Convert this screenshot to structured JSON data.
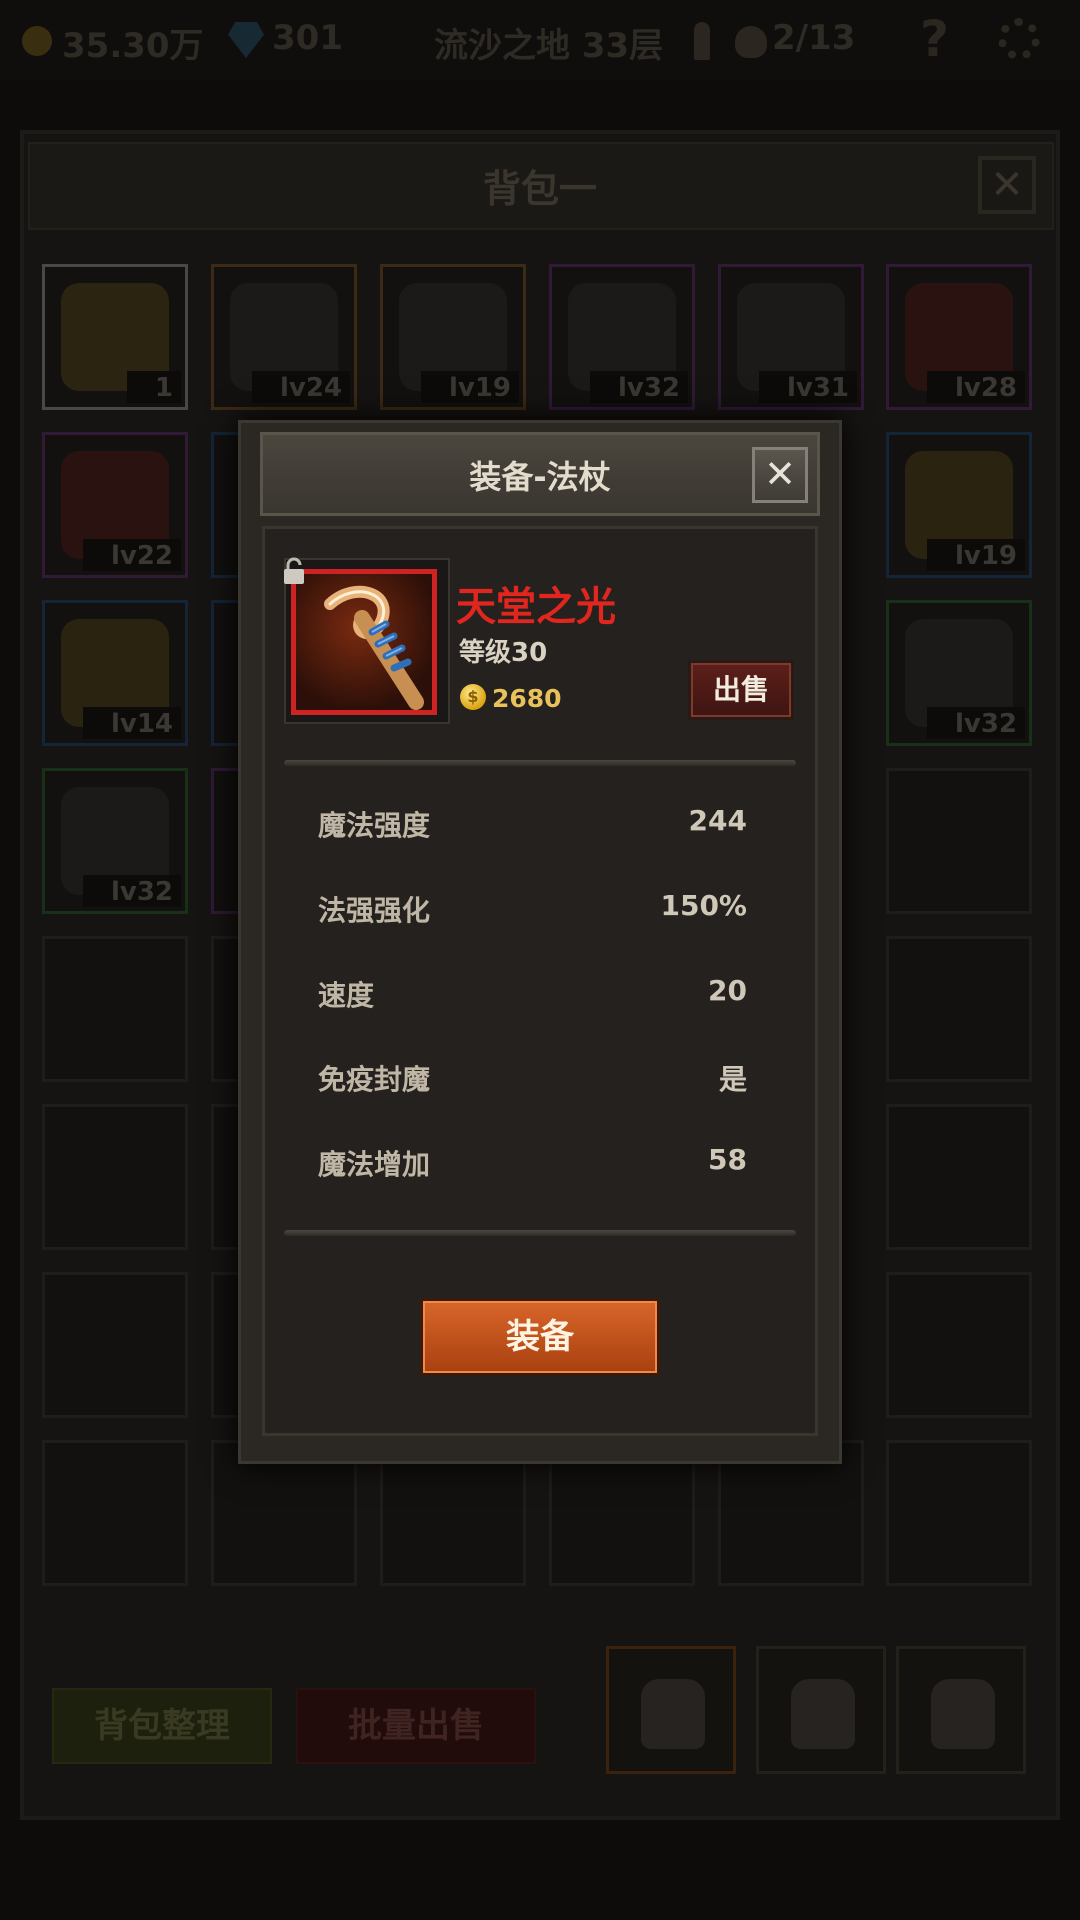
{
  "topbar": {
    "gold": "35.30万",
    "gems": "301",
    "location": "流沙之地 33层",
    "monsters": "2/13",
    "help": "?"
  },
  "bag": {
    "title": "背包一",
    "close": "✕",
    "slots": [
      {
        "lv": "1"
      },
      {
        "lv": "lv24"
      },
      {
        "lv": "lv19"
      },
      {
        "lv": "lv32"
      },
      {
        "lv": "lv31"
      },
      {
        "lv": "lv28"
      },
      {
        "lv": "lv22"
      },
      {
        "lv": "lv19"
      },
      {
        "lv": "lv14"
      },
      {
        "lv": "lv32"
      },
      {
        "lv": "lv32"
      }
    ],
    "sort_button": "背包整理",
    "bulk_sell_button": "批量出售"
  },
  "dialog": {
    "title": "装备-法杖",
    "close": "✕",
    "item": {
      "name": "天堂之光",
      "level": "等级30",
      "price": "2680",
      "name_color": "#e0261f"
    },
    "sell_button": "出售",
    "stats": [
      {
        "label": "魔法强度",
        "value": "244"
      },
      {
        "label": "法强强化",
        "value": "150%"
      },
      {
        "label": "速度",
        "value": "20"
      },
      {
        "label": "免疫封魔",
        "value": "是"
      },
      {
        "label": "魔法增加",
        "value": "58"
      }
    ],
    "equip_button": "装备"
  },
  "colors": {
    "equip_button": "#c8561e",
    "sell_button": "#4e1a16",
    "item_border": "#cf2222",
    "gold_text": "#e8c15b"
  },
  "icons": [
    "coin-icon",
    "gem-icon",
    "key-icon",
    "skull-icon",
    "help-icon",
    "settings-icon",
    "lock-icon",
    "gold-coin-icon",
    "backpack-icon"
  ]
}
